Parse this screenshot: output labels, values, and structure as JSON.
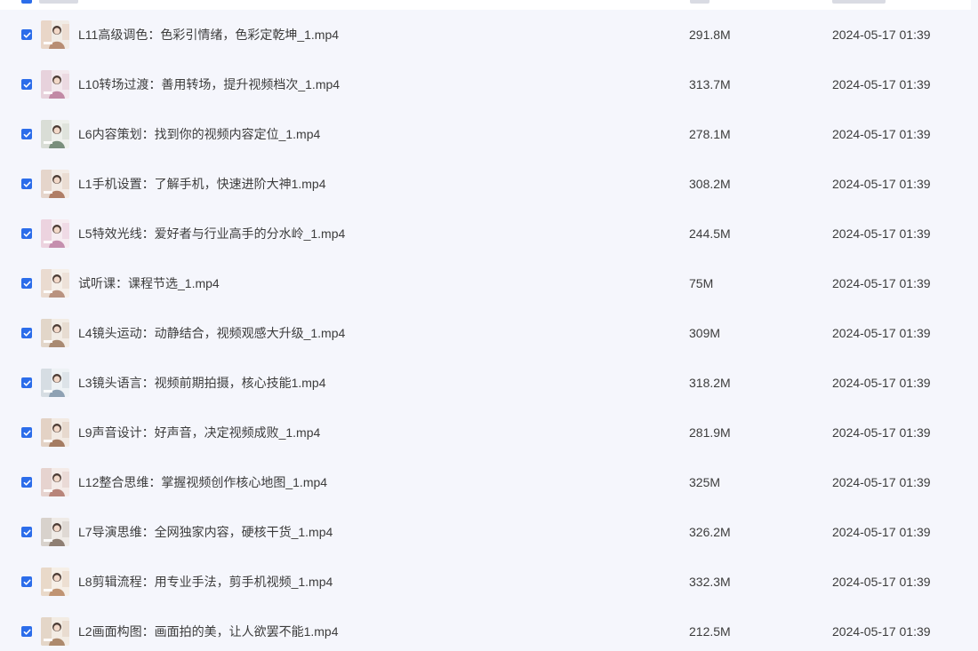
{
  "colors": {
    "accent": "#2c6dea",
    "row_bg": "#f5f6fc",
    "text": "#3c3c3c"
  },
  "files": [
    {
      "name": "L11高级调色：色彩引情绪，色彩定乾坤_1.mp4",
      "size": "291.8M",
      "modified": "2024-05-17 01:39",
      "checked": true,
      "icon": "video-thumbnail"
    },
    {
      "name": "L10转场过渡：善用转场，提升视频档次_1.mp4",
      "size": "313.7M",
      "modified": "2024-05-17 01:39",
      "checked": true,
      "icon": "video-thumbnail"
    },
    {
      "name": "L6内容策划：找到你的视频内容定位_1.mp4",
      "size": "278.1M",
      "modified": "2024-05-17 01:39",
      "checked": true,
      "icon": "video-thumbnail"
    },
    {
      "name": "L1手机设置：了解手机，快速进阶大神1.mp4",
      "size": "308.2M",
      "modified": "2024-05-17 01:39",
      "checked": true,
      "icon": "video-thumbnail"
    },
    {
      "name": "L5特效光线：爱好者与行业高手的分水岭_1.mp4",
      "size": "244.5M",
      "modified": "2024-05-17 01:39",
      "checked": true,
      "icon": "video-thumbnail"
    },
    {
      "name": "试听课：课程节选_1.mp4",
      "size": "75M",
      "modified": "2024-05-17 01:39",
      "checked": true,
      "icon": "video-thumbnail"
    },
    {
      "name": "L4镜头运动：动静结合，视频观感大升级_1.mp4",
      "size": "309M",
      "modified": "2024-05-17 01:39",
      "checked": true,
      "icon": "video-thumbnail"
    },
    {
      "name": "L3镜头语言：视频前期拍摄，核心技能1.mp4",
      "size": "318.2M",
      "modified": "2024-05-17 01:39",
      "checked": true,
      "icon": "video-thumbnail"
    },
    {
      "name": "L9声音设计：好声音，决定视频成败_1.mp4",
      "size": "281.9M",
      "modified": "2024-05-17 01:39",
      "checked": true,
      "icon": "video-thumbnail"
    },
    {
      "name": "L12整合思维：掌握视频创作核心地图_1.mp4",
      "size": "325M",
      "modified": "2024-05-17 01:39",
      "checked": true,
      "icon": "video-thumbnail"
    },
    {
      "name": "L7导演思维：全网独家内容，硬核干货_1.mp4",
      "size": "326.2M",
      "modified": "2024-05-17 01:39",
      "checked": true,
      "icon": "video-thumbnail"
    },
    {
      "name": "L8剪辑流程：用专业手法，剪手机视频_1.mp4",
      "size": "332.3M",
      "modified": "2024-05-17 01:39",
      "checked": true,
      "icon": "video-thumbnail"
    },
    {
      "name": "L2画面构图：画面拍的美，让人欲罢不能1.mp4",
      "size": "212.5M",
      "modified": "2024-05-17 01:39",
      "checked": true,
      "icon": "video-thumbnail"
    }
  ]
}
